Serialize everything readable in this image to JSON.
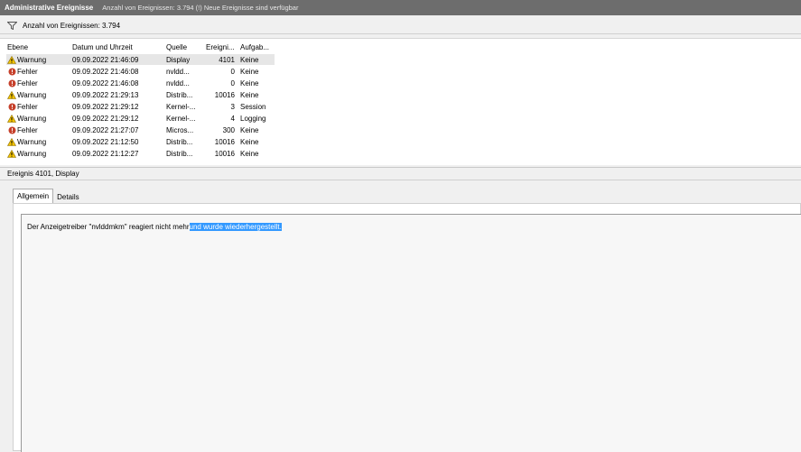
{
  "window": {
    "title": "Administrative Ereignisse",
    "info": "Anzahl von Ereignissen: 3.794 (!) Neue Ereignisse sind verfügbar"
  },
  "filter": {
    "text": "Anzahl von Ereignissen: 3.794",
    "icon": "filter-icon"
  },
  "table": {
    "columns": [
      "Ebene",
      "Datum und Uhrzeit",
      "Quelle",
      "Ereigni...",
      "Aufgab..."
    ],
    "rows": [
      {
        "level": "Warnung",
        "date": "09.09.2022 21:46:09",
        "source": "Display",
        "id": "4101",
        "task": "Keine",
        "selected": true
      },
      {
        "level": "Fehler",
        "date": "09.09.2022 21:46:08",
        "source": "nvldd...",
        "id": "0",
        "task": "Keine"
      },
      {
        "level": "Fehler",
        "date": "09.09.2022 21:46:08",
        "source": "nvldd...",
        "id": "0",
        "task": "Keine"
      },
      {
        "level": "Warnung",
        "date": "09.09.2022 21:29:13",
        "source": "Distrib...",
        "id": "10016",
        "task": "Keine"
      },
      {
        "level": "Fehler",
        "date": "09.09.2022 21:29:12",
        "source": "Kernel-...",
        "id": "3",
        "task": "Session"
      },
      {
        "level": "Warnung",
        "date": "09.09.2022 21:29:12",
        "source": "Kernel-...",
        "id": "4",
        "task": "Logging"
      },
      {
        "level": "Fehler",
        "date": "09.09.2022 21:27:07",
        "source": "Micros...",
        "id": "300",
        "task": "Keine"
      },
      {
        "level": "Warnung",
        "date": "09.09.2022 21:12:50",
        "source": "Distrib...",
        "id": "10016",
        "task": "Keine"
      },
      {
        "level": "Warnung",
        "date": "09.09.2022 21:12:27",
        "source": "Distrib...",
        "id": "10016",
        "task": "Keine"
      }
    ]
  },
  "detail": {
    "title": "Ereignis 4101, Display",
    "tabs": [
      "Allgemein",
      "Details"
    ],
    "active_tab": "Allgemein",
    "message_plain": "Der Anzeigetreiber \"nvlddmkm\" reagiert nicht mehr",
    "message_selected": "und wurde wiederhergestellt."
  },
  "colors": {
    "title_bg": "#6d6d6d",
    "selection": "#3399ff",
    "warning": "#f2c200",
    "error": "#c6402b"
  }
}
